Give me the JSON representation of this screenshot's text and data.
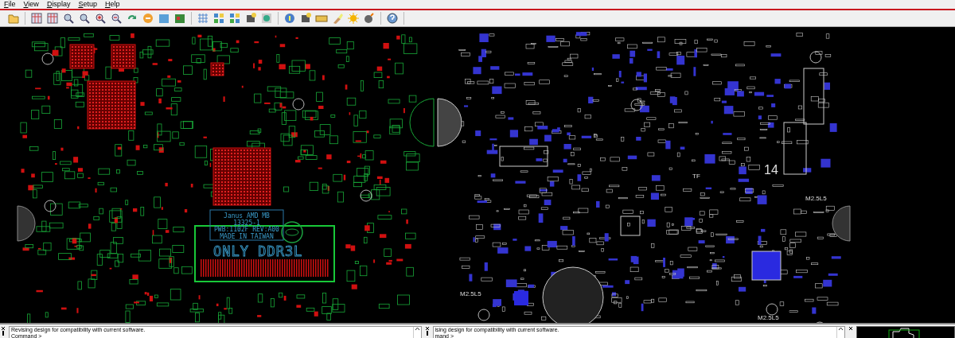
{
  "menu": [
    {
      "label": "File"
    },
    {
      "label": "View"
    },
    {
      "label": "Display"
    },
    {
      "label": "Setup"
    },
    {
      "label": "Help"
    }
  ],
  "board": {
    "label_lines": [
      "Janus AMD MB",
      "13325-1",
      "PWB:1102F REV:A00",
      "MADE IN TAIWAN"
    ],
    "memory_note": "ONLY DDR3L",
    "marks": [
      "14",
      "TF",
      "M2.5L5",
      "M2.5L5",
      "M2.5L5"
    ]
  },
  "console_panes": [
    {
      "lines": [
        "Revising design for compatibility with current software.",
        "Command >"
      ]
    },
    {
      "lines": [
        "ising design for compatibility with current software.",
        "mand >"
      ]
    }
  ]
}
